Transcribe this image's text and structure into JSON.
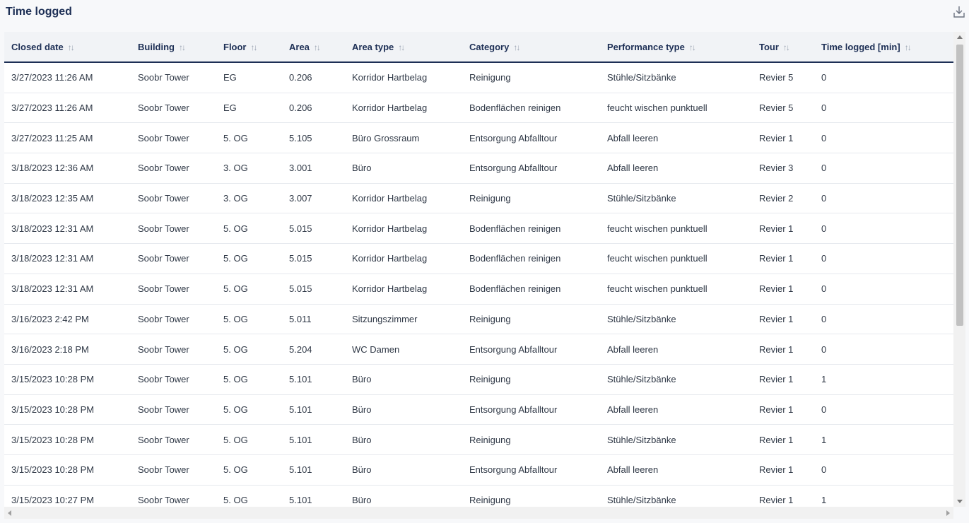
{
  "header": {
    "title": "Time logged",
    "download_icon": "download-icon"
  },
  "table": {
    "sort_icon": "↑↓",
    "columns": [
      "Closed date",
      "Building",
      "Floor",
      "Area",
      "Area type",
      "Category",
      "Performance type",
      "Tour",
      "Time logged [min]"
    ],
    "rows": [
      [
        "3/27/2023 11:26 AM",
        "Soobr Tower",
        "EG",
        "0.206",
        "Korridor Hartbelag",
        "Reinigung",
        "Stühle/Sitzbänke",
        "Revier 5",
        "0"
      ],
      [
        "3/27/2023 11:26 AM",
        "Soobr Tower",
        "EG",
        "0.206",
        "Korridor Hartbelag",
        "Bodenflächen reinigen",
        "feucht wischen punktuell",
        "Revier 5",
        "0"
      ],
      [
        "3/27/2023 11:25 AM",
        "Soobr Tower",
        "5. OG",
        "5.105",
        "Büro Grossraum",
        "Entsorgung Abfalltour",
        "Abfall leeren",
        "Revier 1",
        "0"
      ],
      [
        "3/18/2023 12:36 AM",
        "Soobr Tower",
        "3. OG",
        "3.001",
        "Büro",
        "Entsorgung Abfalltour",
        "Abfall leeren",
        "Revier 3",
        "0"
      ],
      [
        "3/18/2023 12:35 AM",
        "Soobr Tower",
        "3. OG",
        "3.007",
        "Korridor Hartbelag",
        "Reinigung",
        "Stühle/Sitzbänke",
        "Revier 2",
        "0"
      ],
      [
        "3/18/2023 12:31 AM",
        "Soobr Tower",
        "5. OG",
        "5.015",
        "Korridor Hartbelag",
        "Bodenflächen reinigen",
        "feucht wischen punktuell",
        "Revier 1",
        "0"
      ],
      [
        "3/18/2023 12:31 AM",
        "Soobr Tower",
        "5. OG",
        "5.015",
        "Korridor Hartbelag",
        "Bodenflächen reinigen",
        "feucht wischen punktuell",
        "Revier 1",
        "0"
      ],
      [
        "3/18/2023 12:31 AM",
        "Soobr Tower",
        "5. OG",
        "5.015",
        "Korridor Hartbelag",
        "Bodenflächen reinigen",
        "feucht wischen punktuell",
        "Revier 1",
        "0"
      ],
      [
        "3/16/2023 2:42 PM",
        "Soobr Tower",
        "5. OG",
        "5.011",
        "Sitzungszimmer",
        "Reinigung",
        "Stühle/Sitzbänke",
        "Revier 1",
        "0"
      ],
      [
        "3/16/2023 2:18 PM",
        "Soobr Tower",
        "5. OG",
        "5.204",
        "WC Damen",
        "Entsorgung Abfalltour",
        "Abfall leeren",
        "Revier 1",
        "0"
      ],
      [
        "3/15/2023 10:28 PM",
        "Soobr Tower",
        "5. OG",
        "5.101",
        "Büro",
        "Reinigung",
        "Stühle/Sitzbänke",
        "Revier 1",
        "1"
      ],
      [
        "3/15/2023 10:28 PM",
        "Soobr Tower",
        "5. OG",
        "5.101",
        "Büro",
        "Entsorgung Abfalltour",
        "Abfall leeren",
        "Revier 1",
        "0"
      ],
      [
        "3/15/2023 10:28 PM",
        "Soobr Tower",
        "5. OG",
        "5.101",
        "Büro",
        "Reinigung",
        "Stühle/Sitzbänke",
        "Revier 1",
        "1"
      ],
      [
        "3/15/2023 10:28 PM",
        "Soobr Tower",
        "5. OG",
        "5.101",
        "Büro",
        "Entsorgung Abfalltour",
        "Abfall leeren",
        "Revier 1",
        "0"
      ],
      [
        "3/15/2023 10:27 PM",
        "Soobr Tower",
        "5. OG",
        "5.101",
        "Büro",
        "Reinigung",
        "Stühle/Sitzbänke",
        "Revier 1",
        "1"
      ]
    ]
  }
}
